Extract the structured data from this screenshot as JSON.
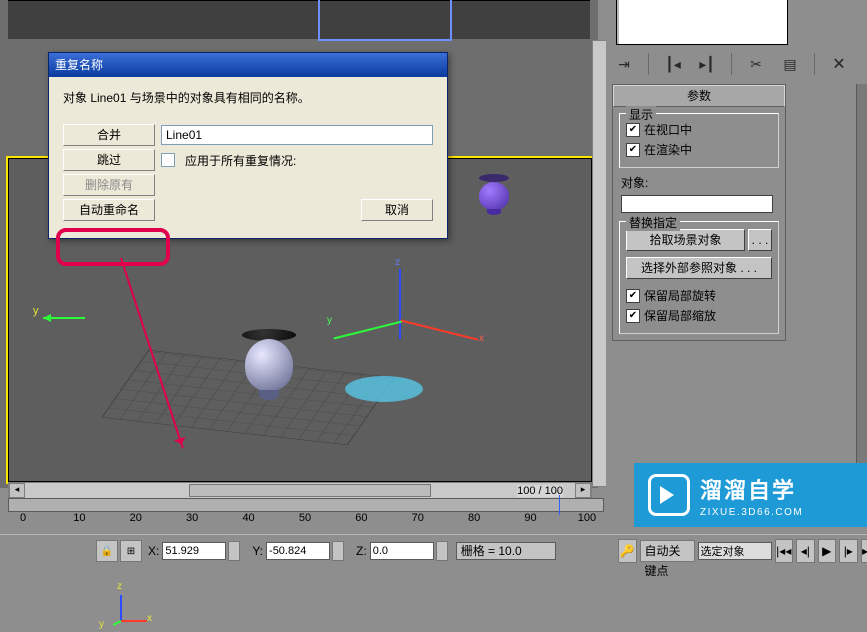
{
  "dialog": {
    "title": "重复名称",
    "message": "对象 Line01 与场景中的对象具有相同的名称。",
    "merge": "合并",
    "skip": "跳过",
    "delete_orig": "删除原有",
    "auto_rename": "自动重命名",
    "cancel": "取消",
    "object_name": "Line01",
    "apply_all": "应用于所有重复情况:"
  },
  "right": {
    "params_title": "参数",
    "display_legend": "显示",
    "in_viewport": "在视口中",
    "in_render": "在渲染中",
    "object_label": "对象:",
    "replace_legend": "替换指定",
    "pick_scene": "拾取场景对象",
    "dots": ". . .",
    "pick_xref": "选择外部参照对象 . . .",
    "keep_rot": "保留局部旋转",
    "keep_scale": "保留局部缩放"
  },
  "ruler": {
    "ticks": [
      "0",
      "10",
      "20",
      "30",
      "40",
      "50",
      "60",
      "70",
      "80",
      "90",
      "100"
    ],
    "readout": "100 / 100"
  },
  "coord": {
    "x_label": "X:",
    "x": "51.929",
    "y_label": "Y:",
    "y": "-50.824",
    "z_label": "Z:",
    "z": "0.0",
    "grid": "栅格 = 10.0",
    "auto_key": "自动关键点",
    "sel_obj": "选定对象"
  },
  "axis": {
    "x": "x",
    "y": "y",
    "z": "z"
  },
  "watermark": {
    "cn": "溜溜自学",
    "en": "ZIXUE.3D66.COM"
  }
}
